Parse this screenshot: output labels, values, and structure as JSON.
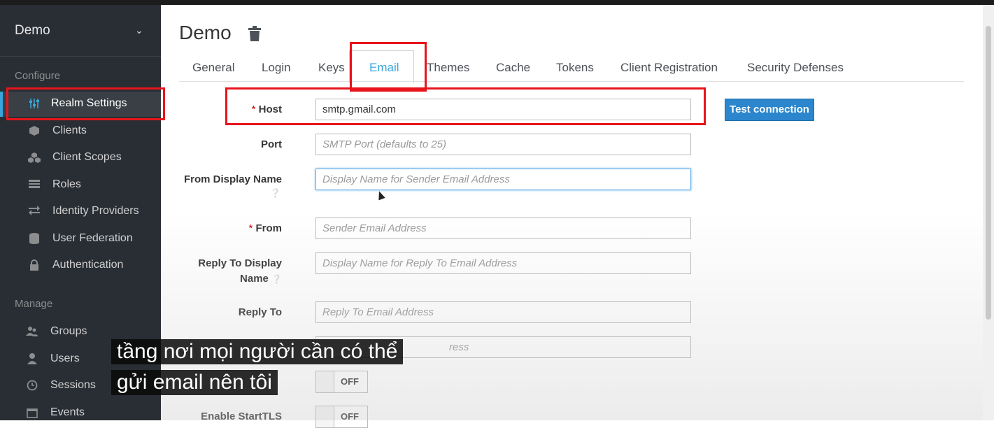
{
  "realm": {
    "name": "Demo"
  },
  "sidebar": {
    "configure_title": "Configure",
    "configure_items": [
      {
        "label": "Realm Settings",
        "icon": "sliders-icon"
      },
      {
        "label": "Clients",
        "icon": "cube-icon"
      },
      {
        "label": "Client Scopes",
        "icon": "cubes-icon"
      },
      {
        "label": "Roles",
        "icon": "list-icon"
      },
      {
        "label": "Identity Providers",
        "icon": "exchange-icon"
      },
      {
        "label": "User Federation",
        "icon": "database-icon"
      },
      {
        "label": "Authentication",
        "icon": "lock-icon"
      }
    ],
    "manage_title": "Manage",
    "manage_items": [
      {
        "label": "Groups",
        "icon": "users-icon"
      },
      {
        "label": "Users",
        "icon": "user-icon"
      },
      {
        "label": "Sessions",
        "icon": "clock-icon"
      },
      {
        "label": "Events",
        "icon": "calendar-icon"
      }
    ]
  },
  "page": {
    "title": "Demo"
  },
  "tabs": [
    "General",
    "Login",
    "Keys",
    "Email",
    "Themes",
    "Cache",
    "Tokens",
    "Client Registration",
    "Security Defenses"
  ],
  "form": {
    "host": {
      "label": "Host",
      "required_mark": "*",
      "value": "smtp.gmail.com"
    },
    "port": {
      "label": "Port",
      "placeholder": "SMTP Port (defaults to 25)"
    },
    "from_display_name": {
      "label": "From Display Name",
      "placeholder": "Display Name for Sender Email Address"
    },
    "from": {
      "label": "From",
      "required_mark": "*",
      "placeholder": "Sender Email Address"
    },
    "reply_to_display_name": {
      "label_line1": "Reply To Display",
      "label_line2": "Name",
      "placeholder": "Display Name for Reply To Email Address"
    },
    "reply_to": {
      "label": "Reply To",
      "placeholder": "Reply To Email Address"
    },
    "envelope_from": {
      "placeholder_visible": "ress"
    },
    "enable_ssl": {
      "state": "OFF"
    },
    "enable_starttls": {
      "label": "Enable StartTLS",
      "state": "OFF"
    },
    "test_button": "Test connection"
  },
  "subtitles": {
    "line1": "tầng nơi mọi người cần có thể",
    "line2": "gửi email nên tôi"
  },
  "colors": {
    "sidebar": "#292e34",
    "accent": "#39a5dc",
    "highlight": "#e8141b",
    "button": "#2b86cd"
  }
}
